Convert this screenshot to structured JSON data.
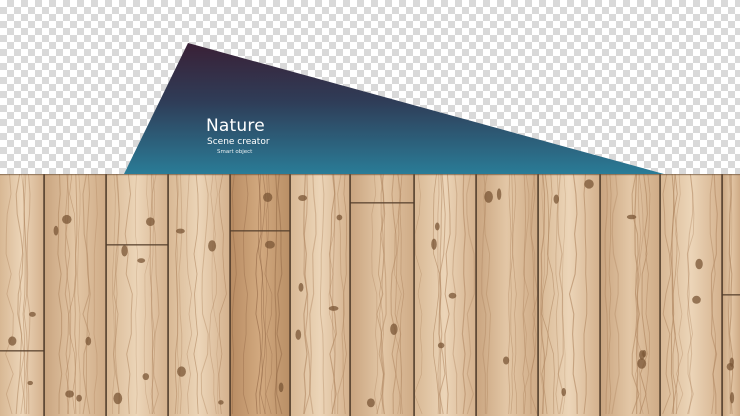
{
  "banner": {
    "title": "Nature",
    "subtitle": "Scene creator",
    "tag": "Smart object",
    "gradient": [
      "#3a2036",
      "#2f3d58",
      "#2a7c97"
    ]
  },
  "canvas": {
    "background": "transparency-checkerboard"
  },
  "floor": {
    "material": "light wood planks",
    "colors": {
      "base": "#d9b896",
      "light": "#e6cdb0",
      "dark": "#b88c63",
      "seam": "#5a4330",
      "knot": "#7a5536"
    }
  }
}
